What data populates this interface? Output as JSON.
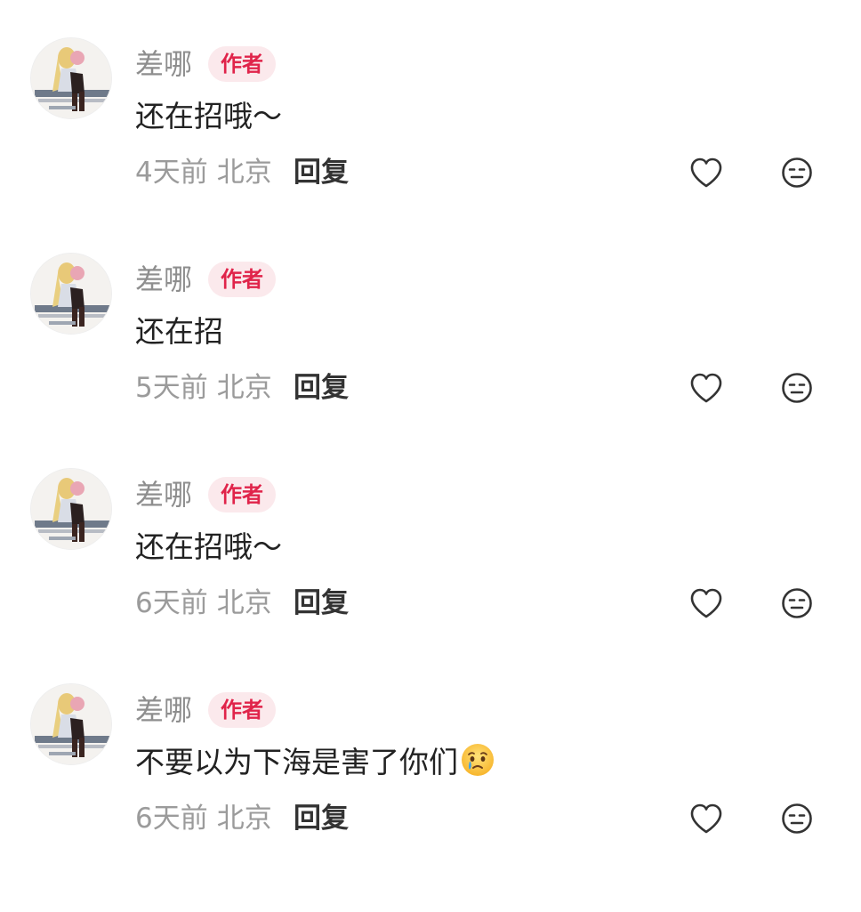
{
  "comments": [
    {
      "username": "差哪",
      "badge": "作者",
      "text": "还在招哦～",
      "time": "4天前",
      "location": "北京",
      "reply_label": "回复",
      "has_emoji": false
    },
    {
      "username": "差哪",
      "badge": "作者",
      "text": "还在招",
      "time": "5天前",
      "location": "北京",
      "reply_label": "回复",
      "has_emoji": false
    },
    {
      "username": "差哪",
      "badge": "作者",
      "text": "还在招哦～",
      "time": "6天前",
      "location": "北京",
      "reply_label": "回复",
      "has_emoji": false
    },
    {
      "username": "差哪",
      "badge": "作者",
      "text": "不要以为下海是害了你们",
      "time": "6天前",
      "location": "北京",
      "reply_label": "回复",
      "has_emoji": true,
      "emoji_name": "crying-face-emoji"
    }
  ],
  "icons": {
    "like": "heart-icon",
    "dislike": "unamused-face-icon"
  },
  "colors": {
    "badge_text": "#e0244a",
    "badge_bg": "#fbe9ec",
    "username": "#8e8e8e",
    "meta": "#9b9b9b"
  }
}
